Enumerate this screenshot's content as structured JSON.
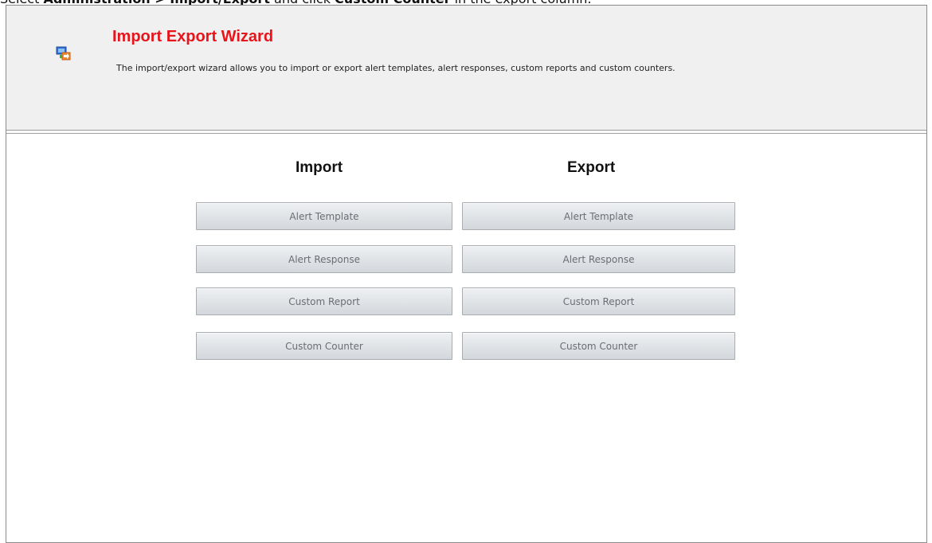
{
  "instruction": {
    "prefix": "Select ",
    "menu_path": "Administration > Import/Export",
    "middle": " and click ",
    "target": "Custom Counter",
    "suffix": " in the export column."
  },
  "wizard": {
    "title": "Import Export Wizard",
    "description": "The import/export wizard allows you to import or export alert templates, alert responses, custom reports and custom counters.",
    "icon": "import-export-wizard-icon"
  },
  "import": {
    "heading": "Import",
    "buttons": [
      "Alert Template",
      "Alert Response",
      "Custom Report",
      "Custom Counter"
    ]
  },
  "export": {
    "heading": "Export",
    "buttons": [
      "Alert Template",
      "Alert Response",
      "Custom Report",
      "Custom Counter"
    ]
  },
  "colors": {
    "title": "#e8141b",
    "header_bg": "#f0f0f0",
    "button_text": "#6a6e73"
  }
}
